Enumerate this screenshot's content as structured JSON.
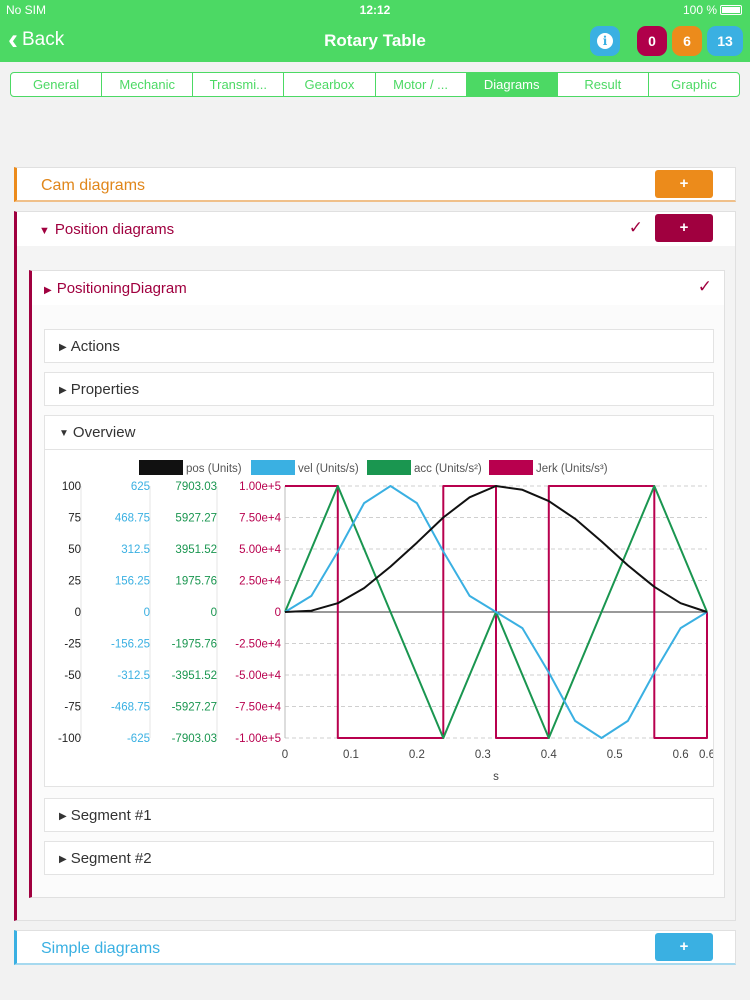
{
  "status_bar": {
    "carrier": "No SIM",
    "time": "12:12",
    "battery": "100 %"
  },
  "nav": {
    "back_label": "Back",
    "title": "Rotary Table",
    "badges": [
      "0",
      "6",
      "13"
    ]
  },
  "tabs": [
    {
      "label": "General"
    },
    {
      "label": "Mechanic"
    },
    {
      "label": "Transmi..."
    },
    {
      "label": "Gearbox"
    },
    {
      "label": "Motor / ..."
    },
    {
      "label": "Diagrams"
    },
    {
      "label": "Result"
    },
    {
      "label": "Graphic"
    }
  ],
  "active_tab": "Diagrams",
  "sections": {
    "cam": {
      "title": "Cam diagrams",
      "button": "+"
    },
    "position": {
      "title": "Position diagrams",
      "button": "+"
    },
    "simple": {
      "title": "Simple diagrams",
      "button": "+"
    }
  },
  "diagram": {
    "title": "PositioningDiagram",
    "subsections": [
      "Actions",
      "Properties",
      "Overview",
      "Segment #1",
      "Segment #2"
    ]
  },
  "colors": {
    "green": "#4cd964",
    "orange": "#ec8b1b",
    "crimson": "#a0003f",
    "blue": "#3ab0e2",
    "acc": "#1a9650",
    "vel": "#3ab0e2",
    "jerk": "#b8004e",
    "pos": "#111111"
  },
  "chart_data": {
    "type": "line",
    "xlabel": "s",
    "x_ticks": [
      "0",
      "0.1",
      "0.2",
      "0.3",
      "0.4",
      "0.5",
      "0.6",
      "0.6"
    ],
    "xlim": [
      0,
      0.64
    ],
    "legend_position": "top",
    "series": [
      {
        "name": "pos (Units)",
        "color": "#111111",
        "ylim": [
          -100,
          100
        ],
        "ticks": [
          "100",
          "75",
          "50",
          "25",
          "0",
          "-25",
          "-50",
          "-75",
          "-100"
        ],
        "x": [
          0,
          0.04,
          0.08,
          0.12,
          0.16,
          0.2,
          0.24,
          0.28,
          0.32,
          0.36,
          0.4,
          0.44,
          0.48,
          0.52,
          0.56,
          0.6,
          0.64
        ],
        "values": [
          0,
          1,
          7,
          19,
          36,
          55,
          75,
          91,
          100,
          97,
          88,
          74,
          56,
          37,
          20,
          7,
          0
        ]
      },
      {
        "name": "vel (Units/s)",
        "color": "#3ab0e2",
        "ylim": [
          -625,
          625
        ],
        "ticks": [
          "625",
          "468.75",
          "312.5",
          "156.25",
          "0",
          "-156.25",
          "-312.5",
          "-468.75",
          "-625"
        ],
        "x": [
          0,
          0.04,
          0.08,
          0.12,
          0.16,
          0.2,
          0.24,
          0.28,
          0.32,
          0.36,
          0.4,
          0.44,
          0.48,
          0.52,
          0.56,
          0.6,
          0.64
        ],
        "values": [
          0,
          80,
          300,
          540,
          625,
          540,
          300,
          80,
          0,
          -80,
          -300,
          -540,
          -625,
          -540,
          -300,
          -80,
          0
        ]
      },
      {
        "name": "acc (Units/s²)",
        "color": "#1a9650",
        "ylim": [
          -7903.03,
          7903.03
        ],
        "ticks": [
          "7903.03",
          "5927.27",
          "3951.52",
          "1975.76",
          "0",
          "-1975.76",
          "-3951.52",
          "-5927.27",
          "-7903.03"
        ],
        "x": [
          0,
          0.08,
          0.16,
          0.24,
          0.32,
          0.4,
          0.48,
          0.56,
          0.64
        ],
        "values": [
          0,
          7903.03,
          0,
          -7903.03,
          0,
          -7903.03,
          0,
          7903.03,
          0
        ]
      },
      {
        "name": "Jerk (Units/s³)",
        "color": "#b8004e",
        "ylim": [
          -100000,
          100000
        ],
        "ticks": [
          "1.00e+5",
          "7.50e+4",
          "5.00e+4",
          "2.50e+4",
          "0",
          "-2.50e+4",
          "-5.00e+4",
          "-7.50e+4",
          "-1.00e+5"
        ],
        "x": [
          0,
          0.08,
          0.08,
          0.24,
          0.24,
          0.32,
          0.32,
          0.4,
          0.4,
          0.48,
          0.48,
          0.56,
          0.56,
          0.64,
          0.64
        ],
        "values": [
          100000,
          100000,
          -100000,
          -100000,
          100000,
          100000,
          -100000,
          -100000,
          100000,
          100000,
          100000,
          100000,
          -100000,
          -100000,
          0
        ]
      }
    ]
  }
}
